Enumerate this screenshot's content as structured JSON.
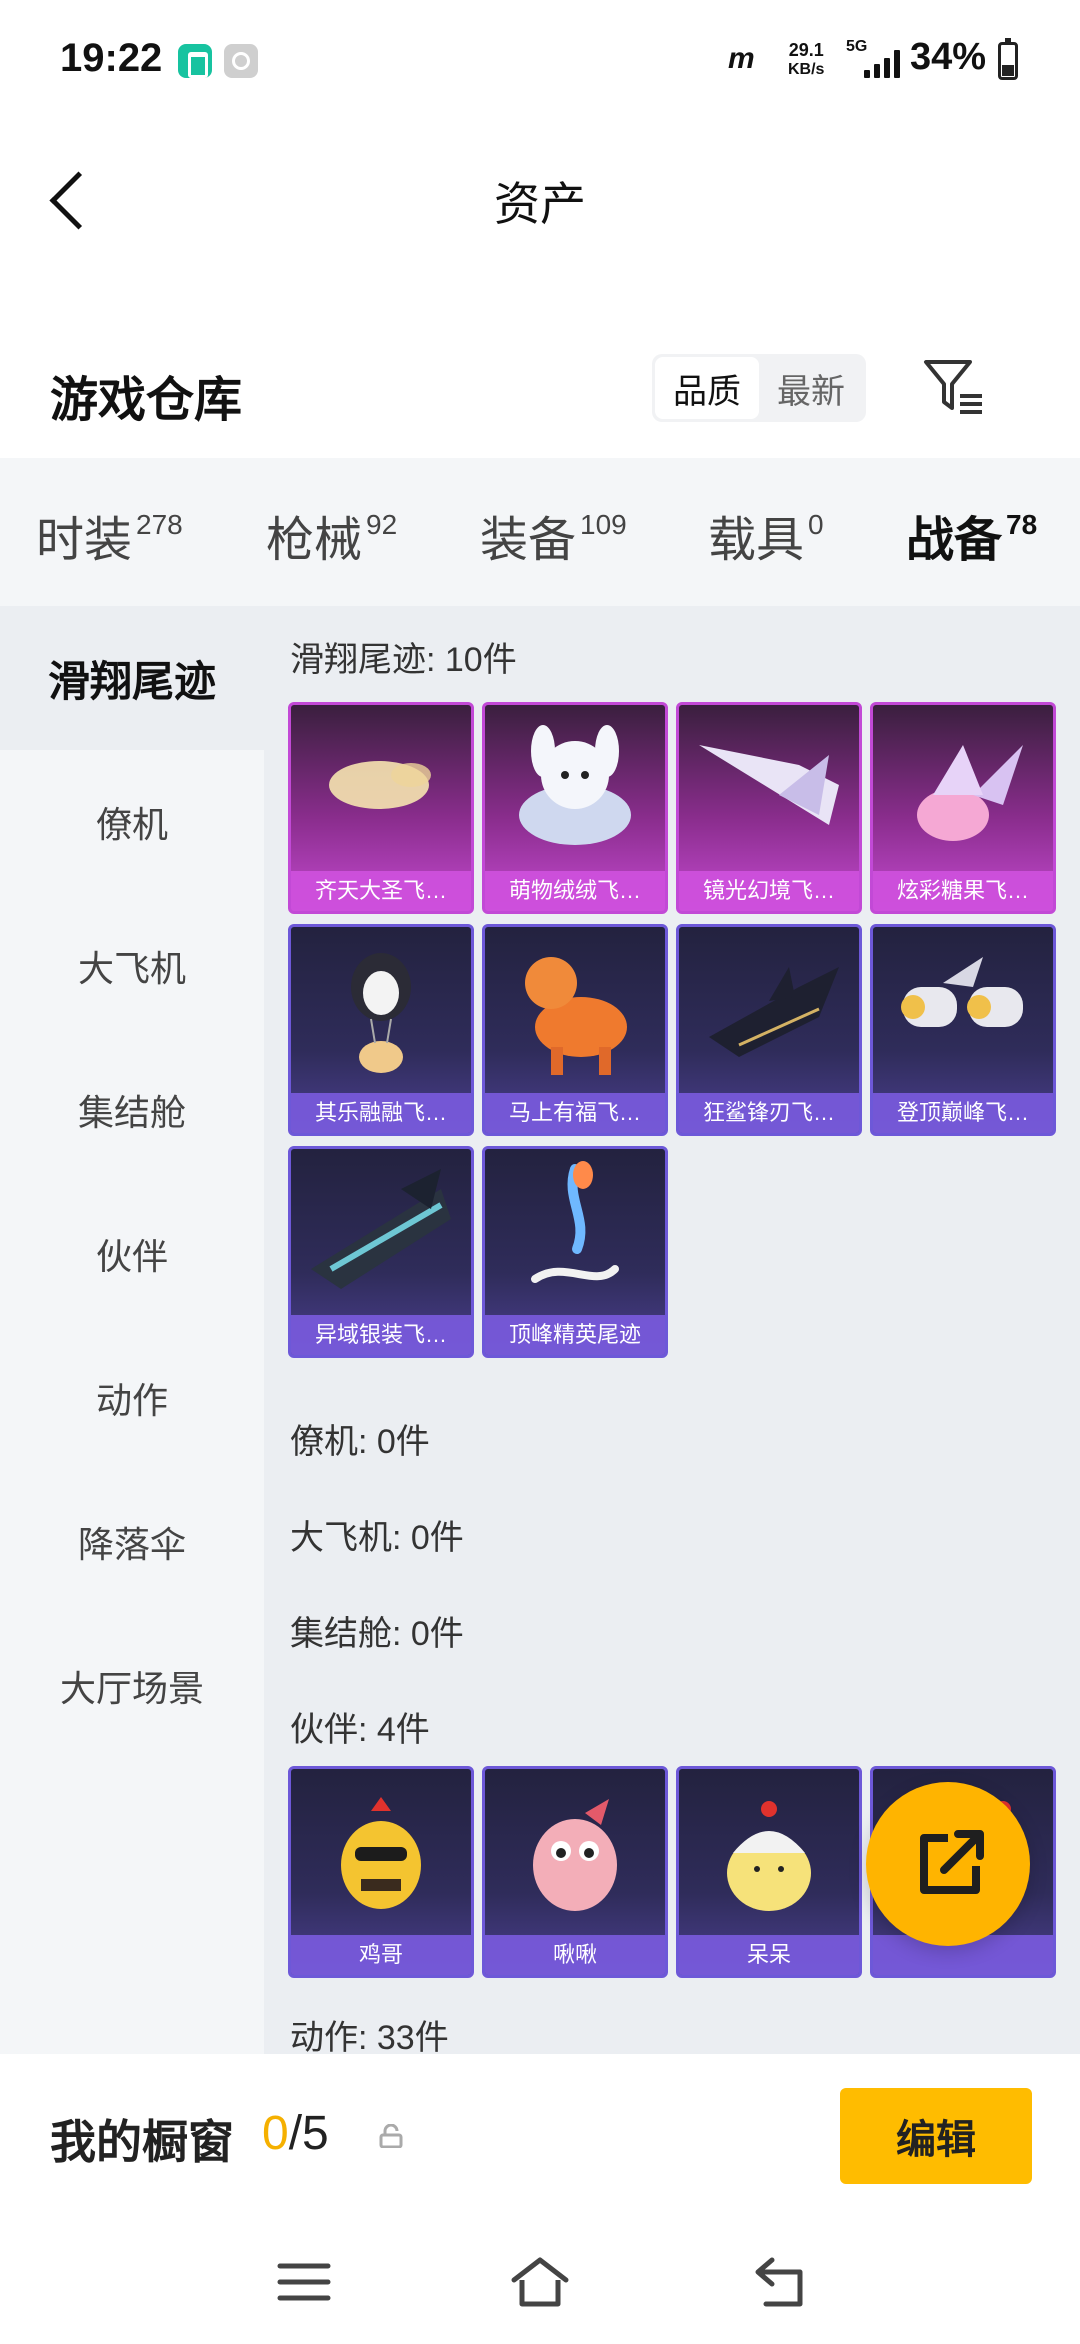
{
  "status_bar": {
    "time": "19:22",
    "network_logo": "m",
    "speed_value": "29.1",
    "speed_unit": "KB/s",
    "network_type": "5G",
    "battery": "34%"
  },
  "header": {
    "title": "资产",
    "back_icon": "chevron-left-icon"
  },
  "warehouse": {
    "title": "游戏仓库",
    "sort_options": [
      "品质",
      "最新"
    ],
    "sort_selected": "品质",
    "filter_icon": "filter-icon"
  },
  "category_tabs": [
    {
      "label": "时装",
      "count": "278"
    },
    {
      "label": "枪械",
      "count": "92"
    },
    {
      "label": "装备",
      "count": "109"
    },
    {
      "label": "载具",
      "count": "0"
    },
    {
      "label": "战备",
      "count": "78"
    }
  ],
  "active_tab": "战备",
  "sidebar": {
    "items": [
      "滑翔尾迹",
      "僚机",
      "大飞机",
      "集结舱",
      "伙伴",
      "动作",
      "降落伞",
      "大厅场景"
    ],
    "active": "滑翔尾迹"
  },
  "groups": {
    "glide": {
      "label": "滑翔尾迹: 10件",
      "items": [
        "齐天大圣飞…",
        "萌物绒绒飞…",
        "镜光幻境飞…",
        "炫彩糖果飞…",
        "其乐融融飞…",
        "马上有福飞…",
        "狂鲨锋刃飞…",
        "登顶巅峰飞…",
        "异域银装飞…",
        "顶峰精英尾迹"
      ]
    },
    "wingman": {
      "label": "僚机: 0件"
    },
    "big_plane": {
      "label": "大飞机: 0件"
    },
    "capsule": {
      "label": "集结舱: 0件"
    },
    "partner": {
      "label": "伙伴: 4件",
      "items": [
        "鸡哥",
        "啾啾",
        "呆呆",
        ""
      ]
    },
    "action": {
      "label": "动作: 33件"
    }
  },
  "fab_icon": "share-icon",
  "showcase": {
    "title": "我的橱窗",
    "current": "0",
    "total": "/5",
    "lock_icon": "lock-icon",
    "edit_label": "编辑"
  },
  "nav": {
    "menu_icon": "menu-icon",
    "home_icon": "home-icon",
    "back_icon": "back-icon"
  }
}
